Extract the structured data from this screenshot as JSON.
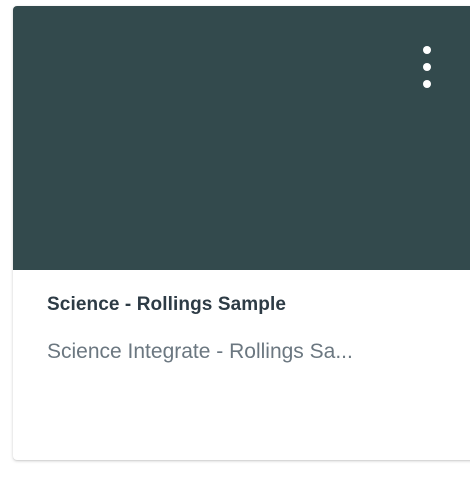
{
  "card": {
    "title": "Science - Rollings Sample",
    "subtitle": "Science Integrate - Rollings Sa...",
    "hero_color": "#334a4d",
    "menu_icon": "kebab-menu-icon"
  }
}
